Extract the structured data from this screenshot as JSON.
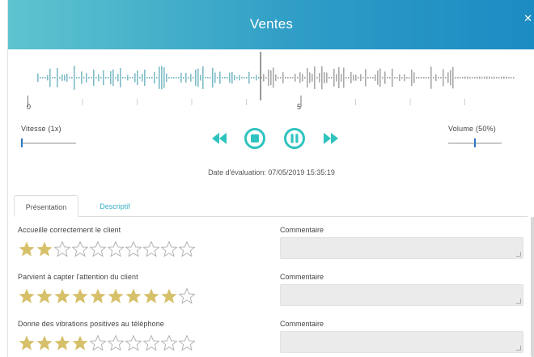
{
  "header": {
    "title": "Ventes",
    "close_icon": "close-icon"
  },
  "waveform": {
    "progress": 0.47,
    "played_color": "#7fbcc6",
    "unplayed_color": "#a9a9a9",
    "cursor_color": "#555555"
  },
  "timeline": {
    "ticks": [
      "0",
      "5"
    ]
  },
  "speed": {
    "label": "Vitesse (1x)",
    "value": 0
  },
  "volume": {
    "label": "Volume (50%)",
    "value": 0.5
  },
  "player": {
    "rewind_icon": "rewind-icon",
    "stop_icon": "stop-icon",
    "pause_icon": "pause-icon",
    "forward_icon": "fast-forward-icon",
    "accent": "#2fc3bf"
  },
  "evaluation_date": "Date d'évaluation: 07/05/2019 15:35:19",
  "tabs": [
    {
      "label": "Présentation",
      "active": true
    },
    {
      "label": "Descriptif",
      "active": false
    }
  ],
  "criteria": [
    {
      "label": "Accueille correctement le client",
      "rating": 2,
      "max": 10,
      "comment_label": "Commentaire",
      "comment": ""
    },
    {
      "label": "Parvient à capter l'attention du client",
      "rating": 9,
      "max": 10,
      "comment_label": "Commentaire",
      "comment": ""
    },
    {
      "label": "Donne des vibrations positives au téléphone",
      "rating": 4,
      "max": 10,
      "comment_label": "Commentaire",
      "comment": ""
    }
  ],
  "colors": {
    "star_filled": "#d7c06a",
    "star_empty": "#b5b5b5",
    "header_start": "#5ec4cf",
    "header_end": "#1b8bc3"
  }
}
